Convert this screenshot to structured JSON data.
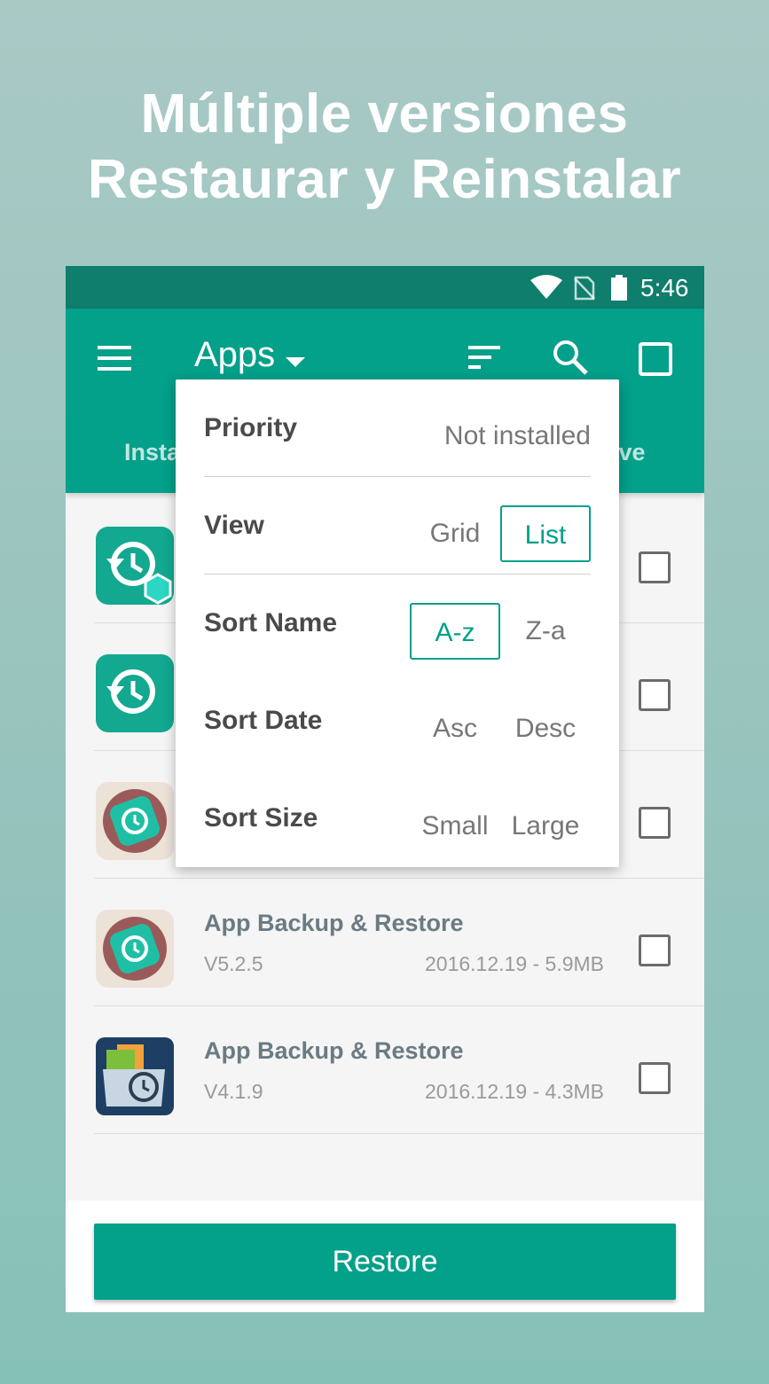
{
  "headline": {
    "line1": "Múltiple versiones",
    "line2": "Restaurar y Reinstalar"
  },
  "status_bar": {
    "time": "5:46",
    "icons": [
      "wifi-icon",
      "no-sim-icon",
      "battery-icon"
    ]
  },
  "app_bar": {
    "title": "Apps",
    "icons": [
      "menu-icon",
      "dropdown-arrow-icon",
      "sort-icon",
      "search-icon",
      "select-all-icon"
    ],
    "tabs": {
      "left_partial": "Insta",
      "right_partial": "Drive"
    }
  },
  "popup": {
    "rows": [
      {
        "label": "Priority",
        "options": [
          "Not installed"
        ],
        "selected": ""
      },
      {
        "label": "View",
        "options": [
          "Grid",
          "List"
        ],
        "selected": "List"
      },
      {
        "label": "Sort Name",
        "options": [
          "A-z",
          "Z-a"
        ],
        "selected": "A-z"
      },
      {
        "label": "Sort Date",
        "options": [
          "Asc",
          "Desc"
        ],
        "selected": ""
      },
      {
        "label": "Sort Size",
        "options": [
          "Small",
          "Large"
        ],
        "selected": ""
      }
    ]
  },
  "list": {
    "items": [
      {
        "title": "",
        "version": "",
        "meta": ""
      },
      {
        "title": "",
        "version": "",
        "meta": ""
      },
      {
        "title": "",
        "version": "",
        "meta": ""
      },
      {
        "title": "App Backup & Restore",
        "version": "V5.2.5",
        "meta": "2016.12.19 - 5.9MB"
      },
      {
        "title": "App Backup & Restore",
        "version": "V4.1.9",
        "meta": "2016.12.19 - 4.3MB"
      }
    ]
  },
  "restore_button": {
    "label": "Restore"
  },
  "colors": {
    "primary": "#03a08a",
    "status_bar": "#0f7e6c",
    "background": "#97c3bd"
  }
}
